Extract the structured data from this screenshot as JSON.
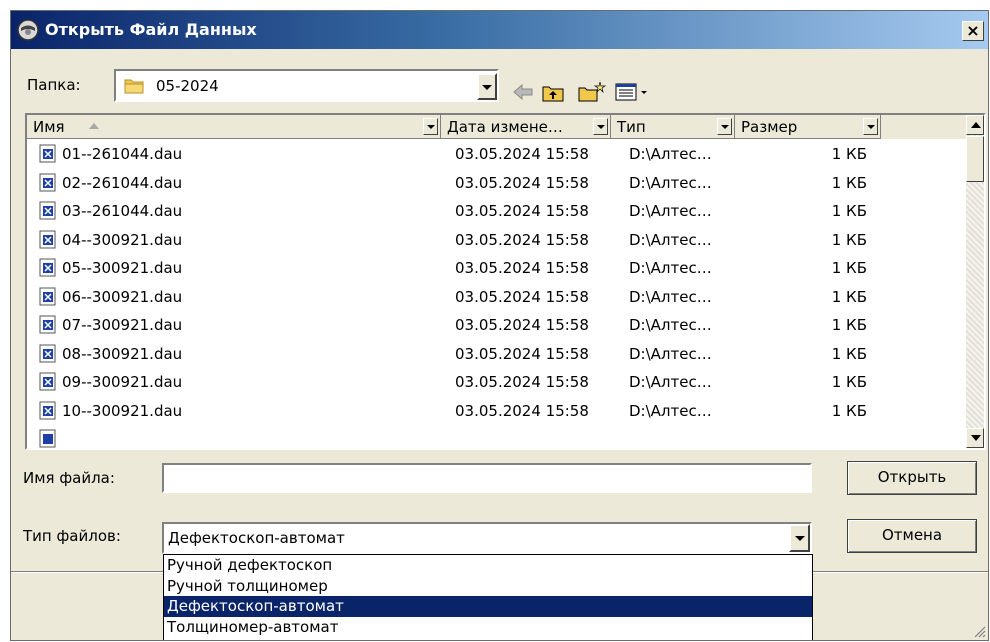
{
  "window": {
    "title": "Открыть Файл Данных",
    "close_glyph": "×"
  },
  "toolbar": {
    "folder_label": "Папка:",
    "folder_value": "05-2024",
    "icons": [
      "back-arrow-icon",
      "up-folder-icon",
      "new-folder-icon",
      "view-menu-icon"
    ]
  },
  "list": {
    "columns": [
      "Имя",
      "Дата измене…",
      "Тип",
      "Размер"
    ],
    "rows": [
      {
        "name": "01--261044.dau",
        "date": "03.05.2024 15:58",
        "type": "D:\\Алтес…",
        "size": "1 КБ"
      },
      {
        "name": "02--261044.dau",
        "date": "03.05.2024 15:58",
        "type": "D:\\Алтес…",
        "size": "1 КБ"
      },
      {
        "name": "03--261044.dau",
        "date": "03.05.2024 15:58",
        "type": "D:\\Алтес…",
        "size": "1 КБ"
      },
      {
        "name": "04--300921.dau",
        "date": "03.05.2024 15:58",
        "type": "D:\\Алтес…",
        "size": "1 КБ"
      },
      {
        "name": "05--300921.dau",
        "date": "03.05.2024 15:58",
        "type": "D:\\Алтес…",
        "size": "1 КБ"
      },
      {
        "name": "06--300921.dau",
        "date": "03.05.2024 15:58",
        "type": "D:\\Алтес…",
        "size": "1 КБ"
      },
      {
        "name": "07--300921.dau",
        "date": "03.05.2024 15:58",
        "type": "D:\\Алтес…",
        "size": "1 КБ"
      },
      {
        "name": "08--300921.dau",
        "date": "03.05.2024 15:58",
        "type": "D:\\Алтес…",
        "size": "1 КБ"
      },
      {
        "name": "09--300921.dau",
        "date": "03.05.2024 15:58",
        "type": "D:\\Алтес…",
        "size": "1 КБ"
      },
      {
        "name": "10--300921.dau",
        "date": "03.05.2024 15:58",
        "type": "D:\\Алтес…",
        "size": "1 КБ"
      }
    ]
  },
  "filename": {
    "label": "Имя файла:",
    "value": ""
  },
  "filetype": {
    "label": "Тип файлов:",
    "value": "Дефектоскоп-автомат",
    "options": [
      "Ручной дефектоскоп",
      "Ручной толщиномер",
      "Дефектоскоп-автомат",
      "Толщиномер-автомат"
    ],
    "selected_index": 2
  },
  "buttons": {
    "open": "Открыть",
    "cancel": "Отмена"
  },
  "colors": {
    "title_start": "#0a246a",
    "title_end": "#a6caf0",
    "selection": "#0a246a",
    "face": "#ece9d8"
  }
}
